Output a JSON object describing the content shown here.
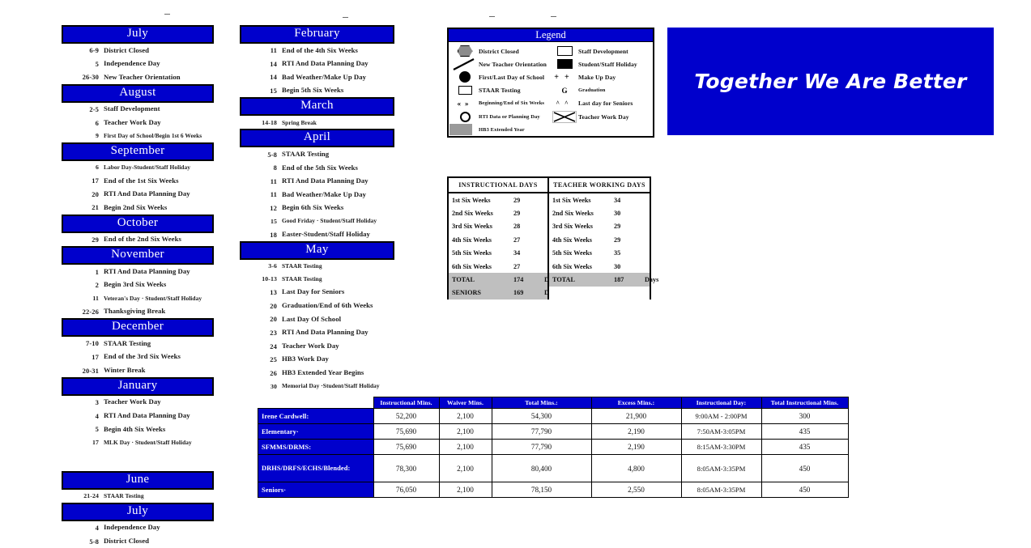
{
  "columns": [
    {
      "name": "left-month-column",
      "months": [
        {
          "name": "July",
          "events": [
            {
              "date": "6-9",
              "text": "District Closed"
            },
            {
              "date": "5",
              "text": "Independence Day"
            },
            {
              "date": "26-30",
              "text": "New Teacher Orientation"
            }
          ]
        },
        {
          "name": "August",
          "events": [
            {
              "date": "2-5",
              "text": "Staff Development"
            },
            {
              "date": "6",
              "text": "Teacher Work Day"
            },
            {
              "date": "9",
              "text": "First Day of School/Begin 1st 6 Weeks",
              "small": true
            }
          ]
        },
        {
          "name": "September",
          "events": [
            {
              "date": "6",
              "text": "Labor Day-Student/Staff Holiday",
              "small": true
            },
            {
              "date": "17",
              "text": "End of the 1st Six Weeks"
            },
            {
              "date": "20",
              "text": "RTI And Data Planning Day"
            },
            {
              "date": "21",
              "text": "Begin 2nd Six Weeks"
            }
          ]
        },
        {
          "name": "October",
          "events": [
            {
              "date": "29",
              "text": "End of the 2nd Six Weeks"
            }
          ]
        },
        {
          "name": "November",
          "events": [
            {
              "date": "1",
              "text": "RTI And Data Planning Day"
            },
            {
              "date": "2",
              "text": "Begin 3rd Six Weeks"
            },
            {
              "date": "11",
              "text": "Veteran's Day · Student/Staff Holiday",
              "small": true
            },
            {
              "date": "22-26",
              "text": "Thanksgiving Break"
            }
          ]
        },
        {
          "name": "December",
          "events": [
            {
              "date": "7-10",
              "text": "STAAR Testing"
            },
            {
              "date": "17",
              "text": "End of the 3rd Six Weeks"
            },
            {
              "date": "20-31",
              "text": "Winter Break"
            }
          ]
        },
        {
          "name": "January",
          "events": [
            {
              "date": "3",
              "text": "Teacher Work Day"
            },
            {
              "date": "4",
              "text": "RTI And Data Planning Day"
            },
            {
              "date": "5",
              "text": "Begin 4th Six Weeks"
            },
            {
              "date": "17",
              "text": "MLK Day · Student/Staff Holiday",
              "small": true
            }
          ]
        },
        {
          "name": "June",
          "events": [
            {
              "date": "21-24",
              "text": "STAAR Testing",
              "small": true
            }
          ]
        },
        {
          "name": "July",
          "events": [
            {
              "date": "4",
              "text": "Independence Day"
            },
            {
              "date": "5-8",
              "text": "District Closed"
            }
          ]
        }
      ]
    },
    {
      "name": "right-month-column",
      "months": [
        {
          "name": "February",
          "events": [
            {
              "date": "11",
              "text": "End of the 4th Six Weeks"
            },
            {
              "date": "14",
              "text": "RTI And Data Planning Day"
            },
            {
              "date": "14",
              "text": "Bad Weather/Make Up Day"
            },
            {
              "date": "15",
              "text": "Begin 5th Six Weeks"
            }
          ]
        },
        {
          "name": "March",
          "events": [
            {
              "date": "14-18",
              "text": "Spring Break",
              "small": true
            }
          ]
        },
        {
          "name": "April",
          "events": [
            {
              "date": "5-8",
              "text": "STAAR Testing"
            },
            {
              "date": "8",
              "text": "End of the 5th Six Weeks"
            },
            {
              "date": "11",
              "text": "RTI And Data Planning Day"
            },
            {
              "date": "11",
              "text": "Bad Weather/Make Up Day"
            },
            {
              "date": "12",
              "text": "Begin 6th Six Weeks"
            },
            {
              "date": "15",
              "text": "Good Friday · Student/Staff Holiday",
              "small": true
            },
            {
              "date": "18",
              "text": "Easter-Student/Staff Holiday"
            }
          ]
        },
        {
          "name": "May",
          "events": [
            {
              "date": "3-6",
              "text": "STAAR Testing",
              "small": true
            },
            {
              "date": "10-13",
              "text": "STAAR Testing",
              "small": true
            },
            {
              "date": "13",
              "text": "Last Day for Seniors"
            },
            {
              "date": "20",
              "text": "Graduation/End of 6th Weeks"
            },
            {
              "date": "20",
              "text": "Last Day Of School"
            },
            {
              "date": "23",
              "text": "RTI And Data Planning Day"
            },
            {
              "date": "24",
              "text": "Teacher Work Day"
            },
            {
              "date": "25",
              "text": "HB3 Work Day"
            },
            {
              "date": "26",
              "text": "HB3 Extended Year Begins"
            },
            {
              "date": "30",
              "text": "Memorial Day ·Student/Staff Holiday",
              "small": true
            }
          ]
        }
      ]
    }
  ],
  "legend": {
    "title": "Legend",
    "left_items": [
      {
        "icon": "hexagon-gray-icon",
        "label": "District Closed"
      },
      {
        "icon": "diagonal-line-icon",
        "label": "New Teacher Orientation"
      },
      {
        "icon": "filled-circle-icon",
        "label": "First/Last Day of School"
      },
      {
        "icon": "open-rectangle-icon",
        "label": "STAAR Testing"
      },
      {
        "icon": "double-chevron-icon",
        "label": "Beginning/End of Six Weeks",
        "small": true
      },
      {
        "icon": "open-circle-icon",
        "label": "RTI Data or Planning Day",
        "small": true
      },
      {
        "icon": "gray-bar-icon",
        "label": "HB3 Extended Year",
        "small": true
      }
    ],
    "right_items": [
      {
        "icon": "white-box-icon",
        "label": "Staff Development"
      },
      {
        "icon": "black-box-icon",
        "label": "Student/Staff Holiday"
      },
      {
        "icon": "plus-plus-icon",
        "label": "Make Up Day"
      },
      {
        "icon": "letter-g-icon",
        "label": "Graduation",
        "small": true
      },
      {
        "icon": "double-caret-icon",
        "label": "Last day for Seniors"
      },
      {
        "icon": "x-box-icon",
        "label": "Teacher Work Day"
      }
    ]
  },
  "days_table": {
    "left": {
      "title": "INSTRUCTIONAL DAYS",
      "rows": [
        {
          "label": "1st Six Weeks",
          "value": "29",
          "unit": ""
        },
        {
          "label": "2nd Six Weeks",
          "value": "29",
          "unit": ""
        },
        {
          "label": "3rd Six Weeks",
          "value": "28",
          "unit": ""
        },
        {
          "label": "4th Six Weeks",
          "value": "27",
          "unit": ""
        },
        {
          "label": "5th Six Weeks",
          "value": "34",
          "unit": ""
        },
        {
          "label": "6th Six Weeks",
          "value": "27",
          "unit": ""
        },
        {
          "label": "TOTAL",
          "value": "174",
          "unit": "Days",
          "total": true
        },
        {
          "label": "SENIORS",
          "value": "169",
          "unit": "Days",
          "total": true
        }
      ]
    },
    "right": {
      "title": "TEACHER WORKING DAYS",
      "rows": [
        {
          "label": "1st Six Weeks",
          "value": "34",
          "unit": ""
        },
        {
          "label": "2nd Six Weeks",
          "value": "30",
          "unit": ""
        },
        {
          "label": "3rd Six Weeks",
          "value": "29",
          "unit": ""
        },
        {
          "label": "4th Six Weeks",
          "value": "29",
          "unit": ""
        },
        {
          "label": "5th Six Weeks",
          "value": "35",
          "unit": ""
        },
        {
          "label": "6th Six Weeks",
          "value": "30",
          "unit": ""
        },
        {
          "label": "TOTAL",
          "value": "187",
          "unit": "Days",
          "total": true
        },
        {
          "label": "",
          "value": "",
          "unit": "",
          "total": true,
          "empty": true
        }
      ]
    }
  },
  "banner": {
    "text": "Together We Are Better",
    "color": "#0000CC"
  },
  "minutes_table": {
    "headers": [
      "",
      "Instructional Mins.",
      "Waiver Mins.",
      "Total Mins.:",
      "Excess Mins.:",
      "Instructional Day:",
      "Total Instructional Mins."
    ],
    "rows": [
      {
        "label": "Irene Cardwell:",
        "cells": [
          "52,200",
          "2,100",
          "54,300",
          "21,900",
          "9:00AM - 2:00PM",
          "300"
        ]
      },
      {
        "label": "Elementary·",
        "cells": [
          "75,690",
          "2,100",
          "77,790",
          "2,190",
          "7:50AM-3:05PM",
          "435"
        ]
      },
      {
        "label": "SFMMS/DRMS:",
        "cells": [
          "75,690",
          "2,100",
          "77,790",
          "2,190",
          "8:15AM-3:30PM",
          "435"
        ]
      },
      {
        "label": "DRHS/DRFS/ECHS/Blended:",
        "cells": [
          "78,300",
          "2,100",
          "80,400",
          "4,800",
          "8:05AM-3:35PM",
          "450"
        ],
        "tall": true
      },
      {
        "label": "Seniors·",
        "cells": [
          "76,050",
          "2,100",
          "78,150",
          "2,550",
          "8:05AM-3:35PM",
          "450"
        ]
      }
    ]
  },
  "theme": {
    "blue": "#0000CC",
    "gray": "#bfbfbf"
  }
}
